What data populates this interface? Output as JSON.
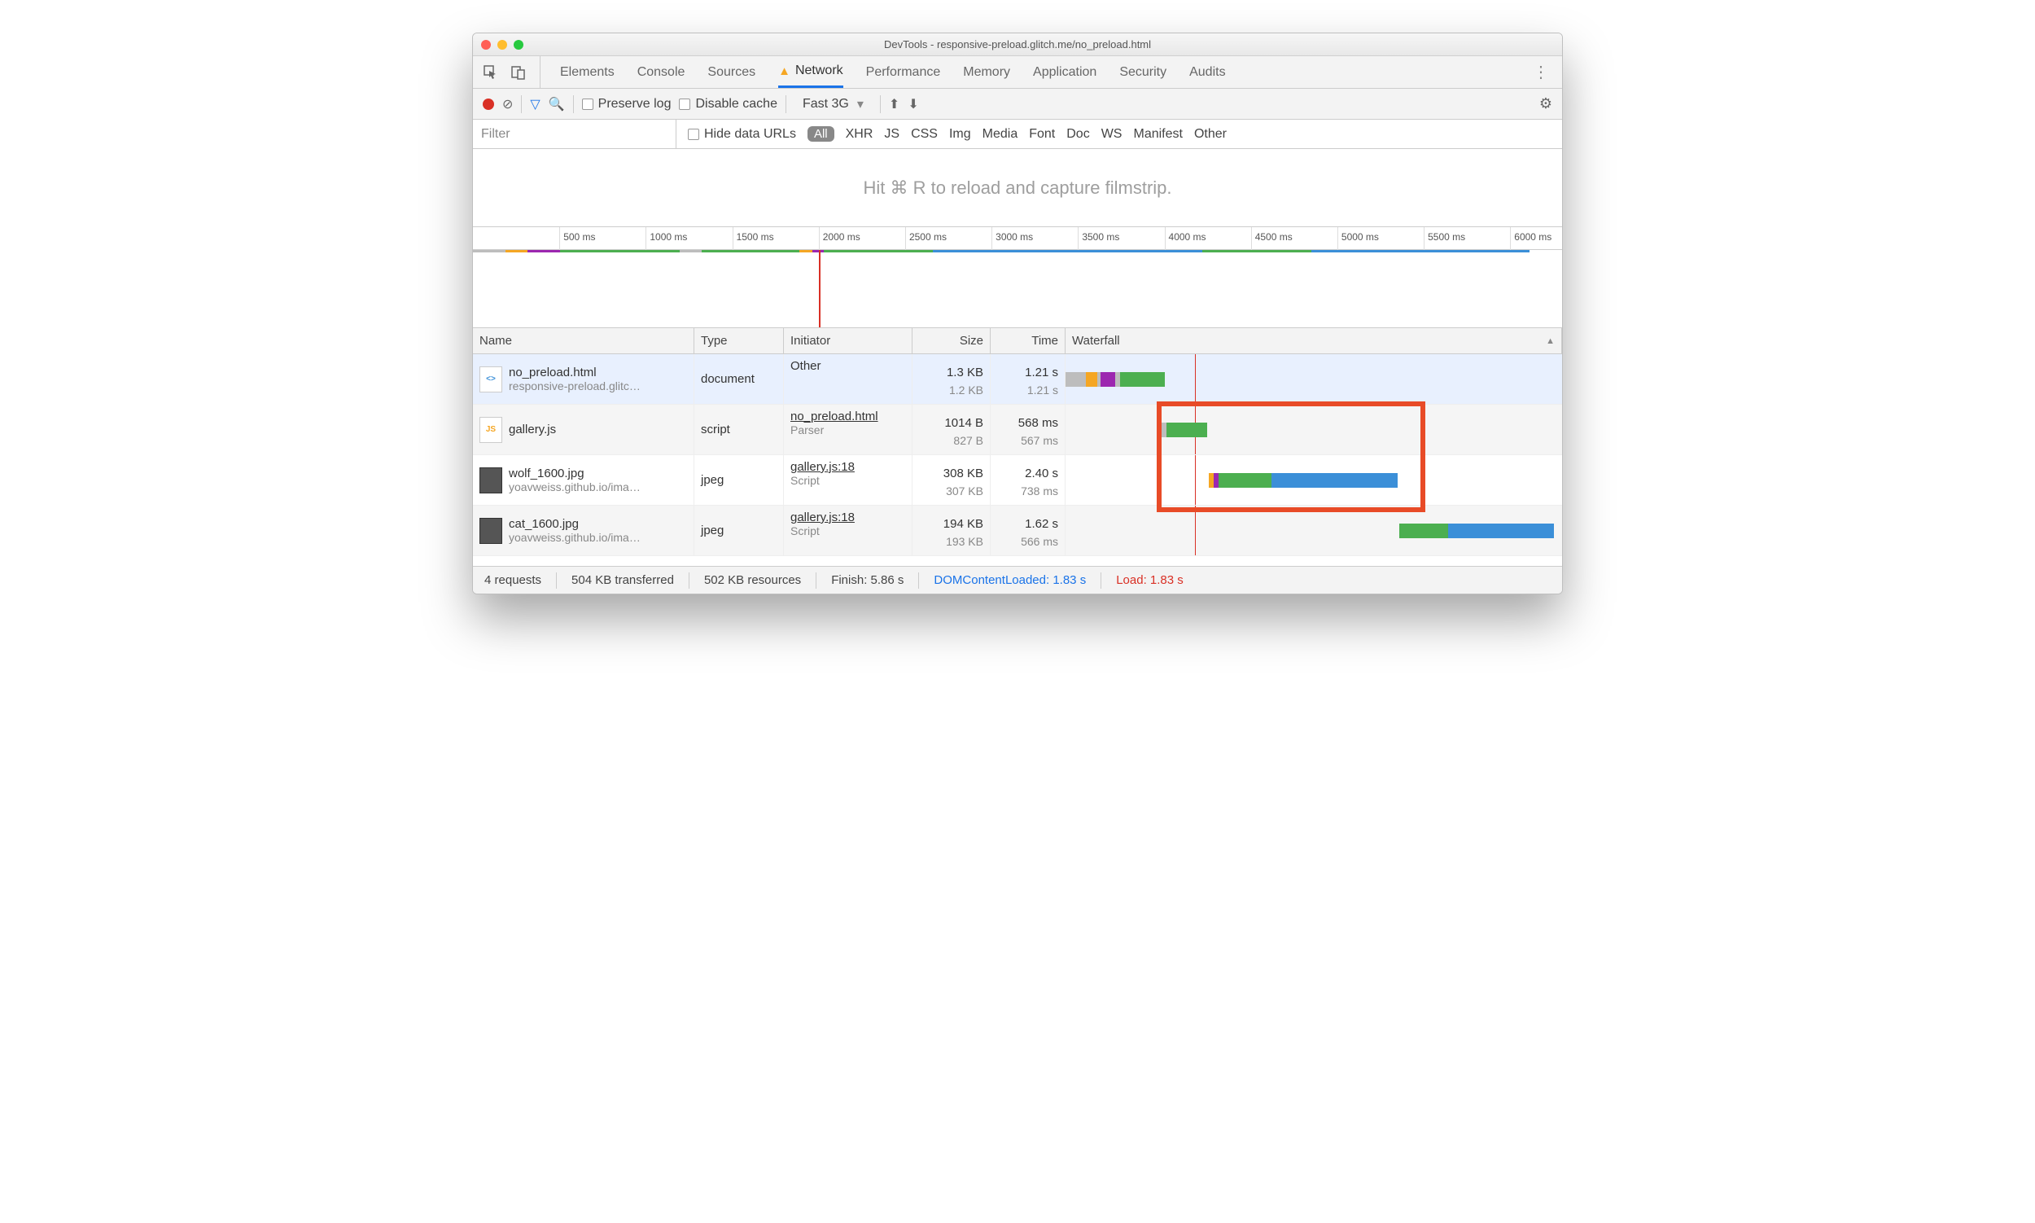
{
  "window_title": "DevTools - responsive-preload.glitch.me/no_preload.html",
  "tabs": [
    "Elements",
    "Console",
    "Sources",
    "Network",
    "Performance",
    "Memory",
    "Application",
    "Security",
    "Audits"
  ],
  "active_tab": "Network",
  "toolbar": {
    "preserve_log": "Preserve log",
    "disable_cache": "Disable cache",
    "throttle": "Fast 3G"
  },
  "filter": {
    "placeholder": "Filter",
    "hide_data_urls": "Hide data URLs",
    "all_label": "All",
    "types": [
      "XHR",
      "JS",
      "CSS",
      "Img",
      "Media",
      "Font",
      "Doc",
      "WS",
      "Manifest",
      "Other"
    ]
  },
  "filmstrip_hint": "Hit ⌘ R to reload and capture filmstrip.",
  "timeline": {
    "ticks": [
      "500 ms",
      "1000 ms",
      "1500 ms",
      "2000 ms",
      "2500 ms",
      "3000 ms",
      "3500 ms",
      "4000 ms",
      "4500 ms",
      "5000 ms",
      "5500 ms",
      "6000 ms"
    ],
    "marker_ms": 2000,
    "range_ms": 6300
  },
  "columns": {
    "name": "Name",
    "type": "Type",
    "initiator": "Initiator",
    "size": "Size",
    "time": "Time",
    "waterfall": "Waterfall"
  },
  "rows": [
    {
      "name": "no_preload.html",
      "sub": "responsive-preload.glitc…",
      "type": "document",
      "initiator": "Other",
      "init_sub": "",
      "size": "1.3 KB",
      "size_sub": "1.2 KB",
      "time": "1.21 s",
      "time_sub": "1.21 s",
      "icon": "html",
      "selected": true,
      "bar": {
        "start": 0,
        "segs": [
          {
            "w": 25,
            "c": "#bdbdbd"
          },
          {
            "w": 14,
            "c": "#f5a623"
          },
          {
            "w": 4,
            "c": "#bdbdbd"
          },
          {
            "w": 18,
            "c": "#9c27b0"
          },
          {
            "w": 6,
            "c": "#bdbdbd"
          },
          {
            "w": 55,
            "c": "#4caf50"
          }
        ]
      }
    },
    {
      "name": "gallery.js",
      "sub": "",
      "type": "script",
      "initiator": "no_preload.html",
      "init_sub": "Parser",
      "size": "1014 B",
      "size_sub": "827 B",
      "time": "568 ms",
      "time_sub": "567 ms",
      "icon": "js",
      "bar": {
        "start": 118,
        "segs": [
          {
            "w": 6,
            "c": "#bdbdbd"
          },
          {
            "w": 50,
            "c": "#4caf50"
          }
        ]
      }
    },
    {
      "name": "wolf_1600.jpg",
      "sub": "yoavweiss.github.io/ima…",
      "type": "jpeg",
      "initiator": "gallery.js:18",
      "init_sub": "Script",
      "size": "308 KB",
      "size_sub": "307 KB",
      "time": "2.40 s",
      "time_sub": "738 ms",
      "icon": "img",
      "bar": {
        "start": 176,
        "segs": [
          {
            "w": 6,
            "c": "#f5a623"
          },
          {
            "w": 6,
            "c": "#9c27b0"
          },
          {
            "w": 65,
            "c": "#4caf50"
          },
          {
            "w": 155,
            "c": "#3b8fd8"
          }
        ]
      }
    },
    {
      "name": "cat_1600.jpg",
      "sub": "yoavweiss.github.io/ima…",
      "type": "jpeg",
      "initiator": "gallery.js:18",
      "init_sub": "Script",
      "size": "194 KB",
      "size_sub": "193 KB",
      "time": "1.62 s",
      "time_sub": "566 ms",
      "icon": "img",
      "bar": {
        "start": 410,
        "segs": [
          {
            "w": 60,
            "c": "#4caf50"
          },
          {
            "w": 130,
            "c": "#3b8fd8"
          }
        ]
      }
    }
  ],
  "highlight": {
    "top_row": 1,
    "rows": 2,
    "left_pct": 17,
    "width_pct": 54
  },
  "status": {
    "requests": "4 requests",
    "transferred": "504 KB transferred",
    "resources": "502 KB resources",
    "finish": "Finish: 5.86 s",
    "dcl": "DOMContentLoaded: 1.83 s",
    "load": "Load: 1.83 s"
  }
}
